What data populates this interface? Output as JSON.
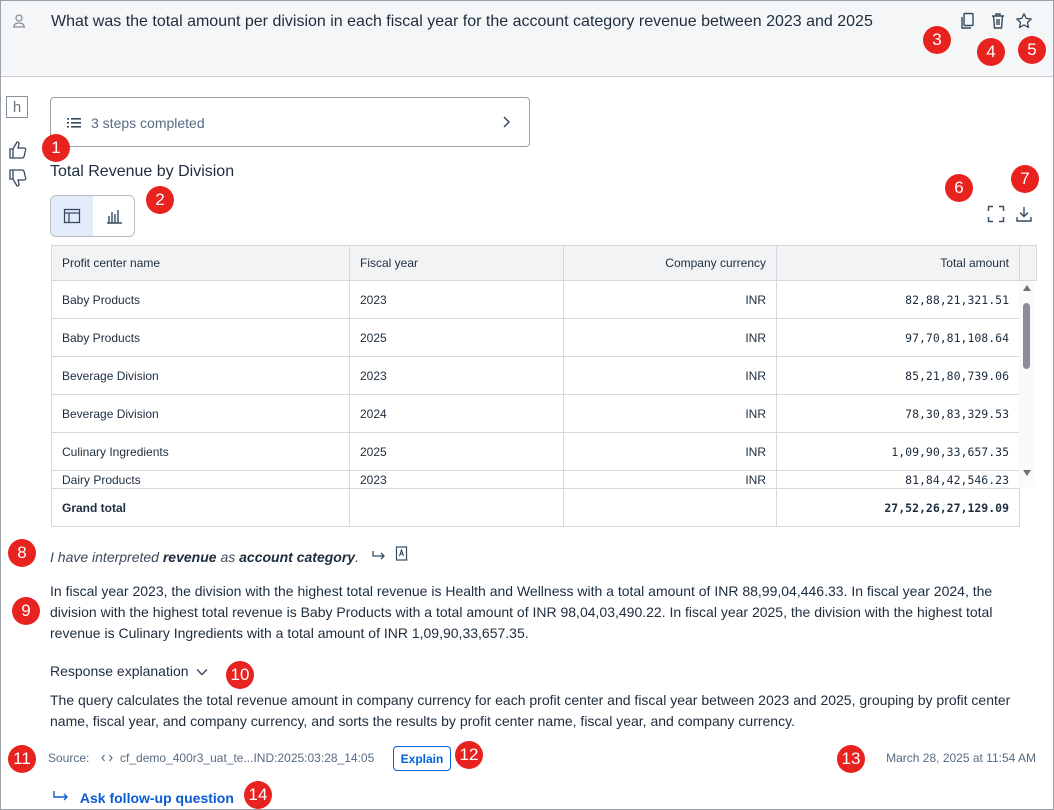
{
  "question": "What was the total amount per division in each fiscal year for the account category revenue between 2023 and 2025",
  "side_logo": "h",
  "steps": {
    "label": "3 steps completed"
  },
  "result_title": "Total Revenue by Division",
  "table": {
    "columns": [
      "Profit center name",
      "Fiscal year",
      "Company currency",
      "Total amount"
    ],
    "rows": [
      [
        "Baby Products",
        "2023",
        "INR",
        "82,88,21,321.51"
      ],
      [
        "Baby Products",
        "2025",
        "INR",
        "97,70,81,108.64"
      ],
      [
        "Beverage Division",
        "2023",
        "INR",
        "85,21,80,739.06"
      ],
      [
        "Beverage Division",
        "2024",
        "INR",
        "78,30,83,329.53"
      ],
      [
        "Culinary Ingredients",
        "2025",
        "INR",
        "1,09,90,33,657.35"
      ],
      [
        "Dairy Products",
        "2023",
        "INR",
        "81,84,42,546.23"
      ]
    ],
    "grand_total_label": "Grand total",
    "grand_total_value": "27,52,26,27,129.09"
  },
  "interpretation": {
    "prefix": "I have interpreted ",
    "term": "revenue",
    "middle": " as ",
    "category": "account category",
    "suffix": "."
  },
  "summary": "In fiscal year 2023, the division with the highest total revenue is Health and Wellness with a total amount of INR 88,99,04,446.33. In fiscal year 2024, the division with the highest total revenue is Baby Products with a total amount of INR 98,04,03,490.22. In fiscal year 2025, the division with the highest total revenue is Culinary Ingredients with a total amount of INR 1,09,90,33,657.35.",
  "explanation_toggle": "Response explanation",
  "explanation": "The query calculates the total revenue amount in company currency for each profit center and fiscal year between 2023 and 2025, grouping by profit center name, fiscal year, and company currency, and sorts the results by profit center name, fiscal year, and company currency.",
  "source": {
    "label": "Source:",
    "value": "cf_demo_400r3_uat_te...IND:2025:03:28_14:05"
  },
  "explain_button": "Explain",
  "timestamp": "March 28, 2025 at 11:54 AM",
  "followup": "Ask follow-up question",
  "badges": [
    "1",
    "2",
    "3",
    "4",
    "5",
    "6",
    "7",
    "8",
    "9",
    "10",
    "11",
    "12",
    "13",
    "14"
  ],
  "colors": {
    "badge": "#e8221f",
    "link": "#0a5bd3",
    "accent_bg": "#e2ecfb"
  }
}
